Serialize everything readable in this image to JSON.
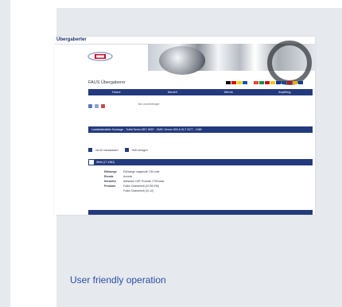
{
  "colors": {
    "caption": "#2b4fa6",
    "navBlue": "#243a7e",
    "panel": "#e6e9ed"
  },
  "screenshot": {
    "page_title": "Übergaberter",
    "app_title": "FAUS Übergaberer",
    "nav": [
      "Home",
      "Modell",
      "Wimrk",
      "Anpflimg"
    ],
    "subtitle": "Bei uhurriehinger",
    "section_title": "Lastdetailsbiblio Sortaage - Torfid Sermi ARC 8057 - VMIC Server 500 & SLT 2077 - CMB",
    "buttons": [
      "Uls ler transarasten",
      "Hele retragen"
    ],
    "detail_header": "Wirte (IT-1982)",
    "details": [
      {
        "key": "Edhaunge",
        "value": "Edhaunge ungepsoft: CM-Liste"
      },
      {
        "key": "Einsatz",
        "value": "Ammok"
      },
      {
        "key": "Hersteller",
        "value": "Manufact: DEF Produkt: CTM-kase"
      },
      {
        "key": "Produkte",
        "value": "Folius Ctalmerheit (10 EB-PW)"
      },
      {
        "key": "",
        "value": "Folius Ctalmerheit (10-12)"
      }
    ],
    "flags": [
      "#000000",
      "#dd0000",
      "#ffce00",
      "#0055a4",
      "#ffffff",
      "#ef4135",
      "#009246",
      "#c60b1e",
      "#ffc400",
      "#003399",
      "#21468b",
      "#ae1c28",
      "#f2a900",
      "#0b3d91"
    ],
    "icons": [
      "print-icon",
      "mail-icon",
      "bookmark-icon"
    ]
  },
  "caption": "User friendly operation"
}
